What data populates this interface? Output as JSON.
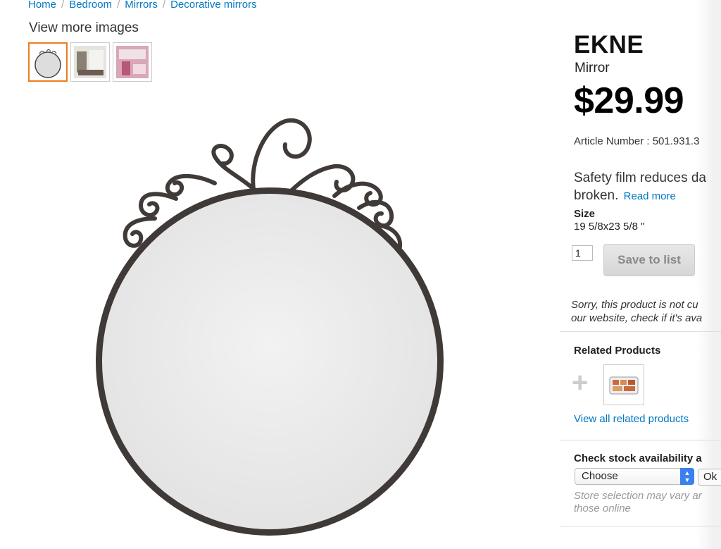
{
  "breadcrumb": {
    "items": [
      "Home",
      "Bedroom",
      "Mirrors",
      "Decorative mirrors"
    ],
    "separator": "/"
  },
  "gallery": {
    "label": "View more images"
  },
  "product": {
    "name": "EKNE",
    "type": "Mirror",
    "price": "$29.99",
    "article_number": "Article Number : 501.931.3",
    "description_line1": "Safety film reduces da",
    "description_line2": "broken.",
    "read_more": "Read more",
    "size_label": "Size",
    "size_value": "19 5/8x23 5/8 \""
  },
  "purchase": {
    "quantity": "1",
    "save_label": "Save to list",
    "sorry_line1": "Sorry, this product is not cu",
    "sorry_line2": "our website, check if it's ava"
  },
  "related": {
    "title": "Related Products",
    "plus": "+",
    "view_all": "View all related products"
  },
  "stock": {
    "title": "Check stock availability a",
    "select_value": "Choose",
    "ok_label": "Ok",
    "note_line1": "Store selection may vary ar",
    "note_line2": "those online"
  },
  "colors": {
    "link": "#0077c1",
    "active_thumb_border": "#f07d1b",
    "select_arrow": "#3b7ff0"
  }
}
